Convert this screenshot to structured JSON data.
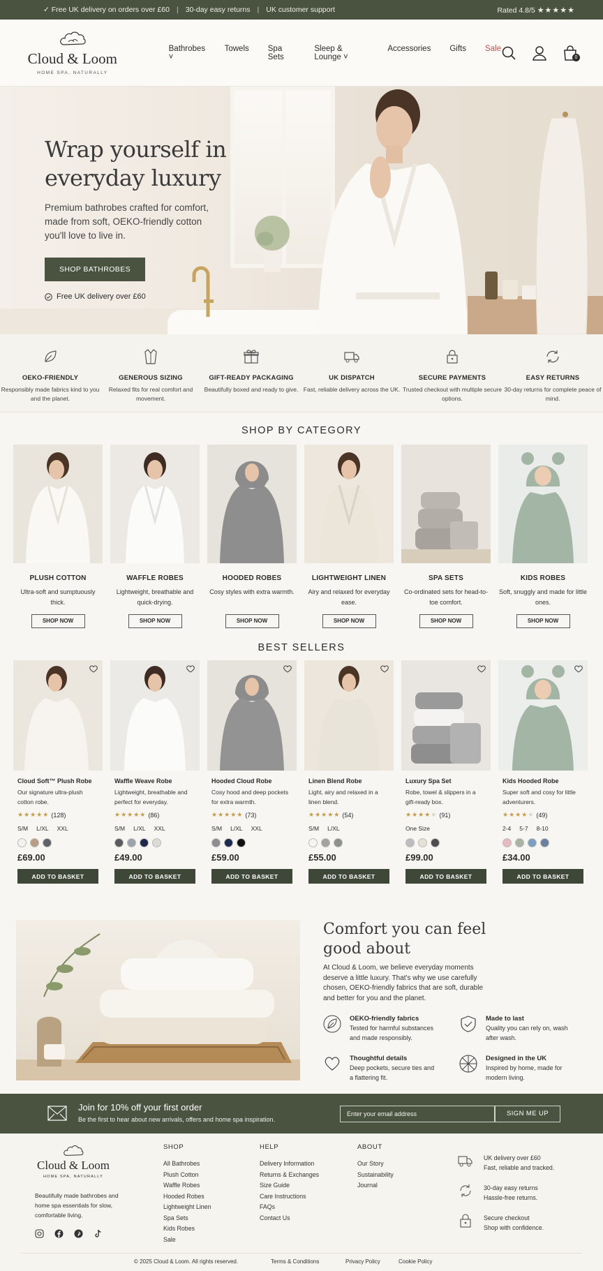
{
  "topbar": {
    "delivery": "Free UK delivery on orders over £60",
    "returns": "30-day easy returns",
    "support": "UK customer support",
    "rating": "Rated 4.8/5",
    "stars": "★★★★★"
  },
  "brand": {
    "name": "Cloud & Loom",
    "tagline": "HOME SPA, NATURALLY"
  },
  "nav": {
    "items": [
      "Bathrobes ˅",
      "Towels",
      "Spa Sets",
      "Sleep & Lounge ˅",
      "Accessories",
      "Gifts",
      "Sale"
    ],
    "cart_count": "0"
  },
  "hero": {
    "title_line1": "Wrap yourself in",
    "title_line2": "everyday luxury",
    "subtitle": "Premium bathrobes crafted for comfort, made from soft, OEKO-friendly cotton you'll love to live in.",
    "cta": "SHOP BATHROBES",
    "note": "Free UK delivery over £60"
  },
  "features": [
    {
      "title": "OEKO-FRIENDLY",
      "desc": "Responsibly made fabrics kind to you and the planet.",
      "icon": "leaf-icon"
    },
    {
      "title": "GENEROUS SIZING",
      "desc": "Relaxed fits for real comfort and movement.",
      "icon": "robe-icon"
    },
    {
      "title": "GIFT-READY PACKAGING",
      "desc": "Beautifully boxed and ready to give.",
      "icon": "gift-icon"
    },
    {
      "title": "UK DISPATCH",
      "desc": "Fast, reliable delivery across the UK.",
      "icon": "truck-icon"
    },
    {
      "title": "SECURE PAYMENTS",
      "desc": "Trusted checkout with multiple secure options.",
      "icon": "lock-icon"
    },
    {
      "title": "EASY RETURNS",
      "desc": "30-day returns for complete peace of mind.",
      "icon": "refresh-icon"
    }
  ],
  "categories": {
    "title": "SHOP BY CATEGORY",
    "button": "SHOP NOW",
    "items": [
      {
        "title": "PLUSH COTTON",
        "desc": "Ultra-soft and sumptuously thick."
      },
      {
        "title": "WAFFLE ROBES",
        "desc": "Lightweight, breathable and quick-drying."
      },
      {
        "title": "HOODED ROBES",
        "desc": "Cosy styles with extra warmth."
      },
      {
        "title": "LIGHTWEIGHT LINEN",
        "desc": "Airy and relaxed for everyday ease."
      },
      {
        "title": "SPA SETS",
        "desc": "Co-ordinated sets for head-to-toe comfort."
      },
      {
        "title": "KIDS ROBES",
        "desc": "Soft, snuggly and made for little ones."
      }
    ]
  },
  "bestsellers": {
    "title": "BEST SELLERS",
    "add_label": "ADD TO BASKET",
    "items": [
      {
        "name": "Cloud Soft™ Plush Robe",
        "desc": "Our signature ultra-plush cotton robe.",
        "rating": 4.5,
        "reviews": "(128)",
        "sizes": [
          "S/M",
          "L/XL",
          "XXL"
        ],
        "colors": [
          "#f4f2ee",
          "#b89e86",
          "#5f6069"
        ],
        "price": "£69.00"
      },
      {
        "name": "Waffle Weave Robe",
        "desc": "Lightweight, breathable and perfect for everyday.",
        "rating": 4.5,
        "reviews": "(86)",
        "sizes": [
          "S/M",
          "L/XL",
          "XXL"
        ],
        "colors": [
          "#5a5b5e",
          "#9aa3ac",
          "#1f2a4a",
          "#dcdbd4"
        ],
        "price": "£49.00"
      },
      {
        "name": "Hooded Cloud Robe",
        "desc": "Cosy hood and deep pockets for extra warmth.",
        "rating": 4.5,
        "reviews": "(73)",
        "sizes": [
          "S/M",
          "L/XL",
          "XXL"
        ],
        "colors": [
          "#8e8e8e",
          "#1e2b4c",
          "#111111"
        ],
        "price": "£59.00"
      },
      {
        "name": "Linen Blend Robe",
        "desc": "Light, airy and relaxed in a linen blend.",
        "rating": 4.5,
        "reviews": "(54)",
        "sizes": [
          "S/M",
          "L/XL"
        ],
        "colors": [
          "#f6f5f2",
          "#a5a39d",
          "#8e908a"
        ],
        "price": "£55.00"
      },
      {
        "name": "Luxury Spa Set",
        "desc": "Robe, towel & slippers in a gift-ready box.",
        "rating": 4,
        "reviews": "(91)",
        "sizes": [
          "One Size"
        ],
        "colors": [
          "#bdbdbd",
          "#e4e1d6",
          "#4d4d4d"
        ],
        "price": "£99.00"
      },
      {
        "name": "Kids Hooded Robe",
        "desc": "Super soft and cosy for little adventurers.",
        "rating": 4,
        "reviews": "(49)",
        "sizes": [
          "2-4",
          "5-7",
          "8-10"
        ],
        "colors": [
          "#e8b9bf",
          "#a9b4a2",
          "#7aa0c0",
          "#6c7f9e"
        ],
        "price": "£34.00"
      }
    ]
  },
  "story": {
    "title_line1": "Comfort you can feel",
    "title_line2": "good about",
    "lead": "At Cloud & Loom, we believe everyday moments deserve a little luxury. That's why we use carefully chosen, OEKO-friendly fabrics that are soft, durable and better for you and the planet.",
    "points": [
      {
        "title": "OEKO-friendly fabrics",
        "desc": "Tested for harmful substances and made responsibly.",
        "icon": "leaf-icon"
      },
      {
        "title": "Made to last",
        "desc": "Quality you can rely on, wash after wash.",
        "icon": "shield-check-icon"
      },
      {
        "title": "Thoughtful details",
        "desc": "Deep pockets, secure ties and a flattering fit.",
        "icon": "heart-icon"
      },
      {
        "title": "Designed in the UK",
        "desc": "Inspired by home, made for modern living.",
        "icon": "uk-flag-icon"
      }
    ]
  },
  "newsletter": {
    "title": "Join for 10% off your first order",
    "subtitle": "Be the first to hear about new arrivals, offers and home spa inspiration.",
    "placeholder": "Enter your email address",
    "button": "SIGN ME UP"
  },
  "footer": {
    "desc": "Beautifully made bathrobes and home spa essentials for slow, comfortable living.",
    "columns": [
      {
        "title": "SHOP",
        "links": [
          "All Bathrobes",
          "Plush Cotton",
          "Waffle Robes",
          "Hooded Robes",
          "Lightweight Linen",
          "Spa Sets",
          "Kids Robes",
          "Sale"
        ]
      },
      {
        "title": "HELP",
        "links": [
          "Delivery Information",
          "Returns & Exchanges",
          "Size Guide",
          "Care Instructions",
          "FAQs",
          "Contact Us"
        ]
      },
      {
        "title": "ABOUT",
        "links": [
          "Our Story",
          "Sustainability",
          "Journal"
        ]
      }
    ],
    "perks": [
      {
        "line1": "UK delivery over £60",
        "line2": "Fast, reliable and tracked."
      },
      {
        "line1": "30-day easy returns",
        "line2": "Hassle-free returns."
      },
      {
        "line1": "Secure checkout",
        "line2": "Shop with confidence."
      }
    ],
    "copyright": "© 2025 Cloud & Loom. All rights reserved.",
    "legal": [
      "Terms & Conditions",
      "Privacy Policy",
      "Cookie Policy"
    ]
  },
  "colors": {
    "accent": "#4a5340",
    "sale": "#c0504d",
    "star": "#c89a48",
    "background": "#f8f6f2"
  }
}
